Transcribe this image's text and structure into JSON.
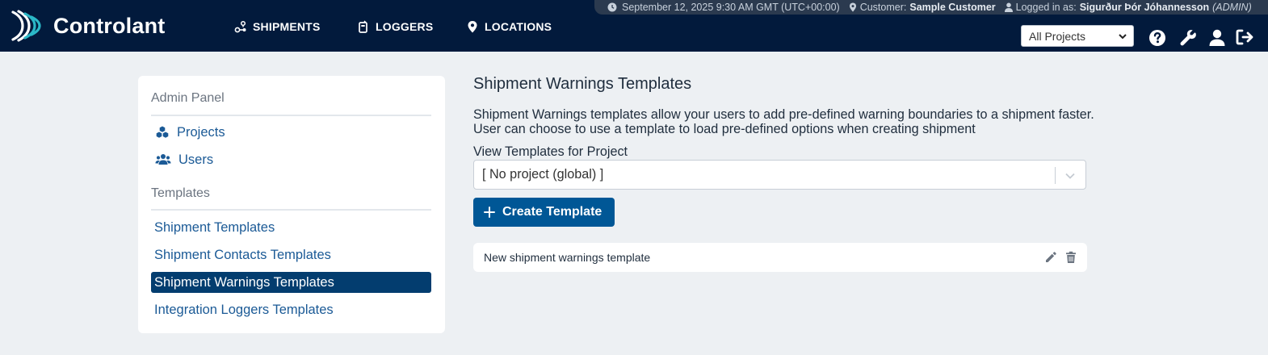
{
  "brand": {
    "name": "Controlant",
    "logo_icon": "controlant-logo-icon"
  },
  "nav": {
    "items": [
      {
        "label": "SHIPMENTS",
        "icon": "shipments-icon"
      },
      {
        "label": "LOGGERS",
        "icon": "logger-icon"
      },
      {
        "label": "LOCATIONS",
        "icon": "map-pin-icon"
      }
    ]
  },
  "infobar": {
    "datetime": "September 12, 2025 9:30 AM GMT (UTC+00:00)",
    "customer_label": "Customer:",
    "customer_name": "Sample Customer",
    "logged_label": "Logged in as:",
    "user_name": "Sigurður Þór Jóhannesson",
    "user_role": "(ADMIN)"
  },
  "project_select": {
    "selected": "All Projects"
  },
  "top_icons": [
    "help-icon",
    "wrench-icon",
    "user-icon",
    "logout-icon"
  ],
  "sidebar": {
    "admin_heading": "Admin Panel",
    "admin_items": [
      {
        "label": "Projects",
        "icon": "cubes-icon"
      },
      {
        "label": "Users",
        "icon": "users-icon"
      }
    ],
    "templates_heading": "Templates",
    "template_items": [
      {
        "label": "Shipment Templates",
        "active": false
      },
      {
        "label": "Shipment Contacts Templates",
        "active": false
      },
      {
        "label": "Shipment Warnings Templates",
        "active": true
      },
      {
        "label": "Integration Loggers Templates",
        "active": false
      }
    ]
  },
  "main": {
    "title": "Shipment Warnings Templates",
    "description": "Shipment Warnings templates allow your users to add pre-defined warning boundaries to a shipment faster. User can choose to use a template to load pre-defined options when creating shipment",
    "project_label": "View Templates for Project",
    "project_value": "[ No project (global) ]",
    "create_button": "Create Template",
    "templates": [
      {
        "name": "New shipment warnings template"
      }
    ]
  },
  "colors": {
    "navbar": "#021a3c",
    "accent": "#005796",
    "active_item": "#033d6f",
    "link": "#1b5a96",
    "logo_teal": "#2bb8c7"
  }
}
